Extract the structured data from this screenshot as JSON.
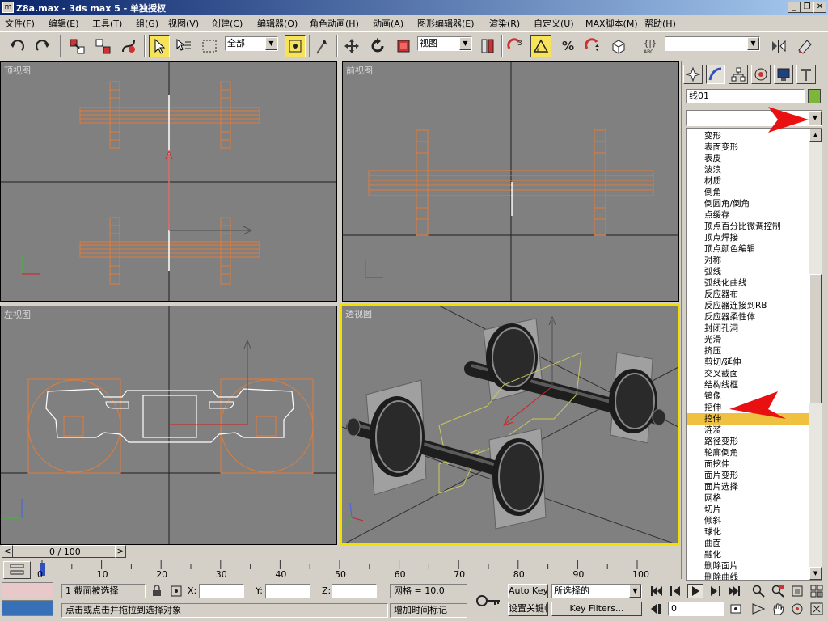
{
  "window": {
    "title": "Z8a.max - 3ds max 5 - 单独授权",
    "icon": "max-app-icon",
    "minimize": "_",
    "maximize": "❐",
    "close": "✕"
  },
  "menu": [
    "文件(F)",
    "编辑(E)",
    "工具(T)",
    "组(G)",
    "视图(V)",
    "创建(C)",
    "编辑器(O)",
    "角色动画(H)",
    "动画(A)",
    "图形编辑器(E)",
    "渲染(R)",
    "自定义(U)",
    "MAX脚本(M)",
    "帮助(H)"
  ],
  "toolbar": {
    "selection_filter": "全部",
    "reference_coord": "视图",
    "named_selection": ""
  },
  "viewports": {
    "top": "顶视图",
    "front": "前视图",
    "left": "左视图",
    "perspective": "透视图"
  },
  "command_panel": {
    "tabs": [
      "create-icon",
      "modify-icon",
      "hierarchy-icon",
      "motion-icon",
      "display-icon",
      "utilities-icon"
    ],
    "object_name": "线01",
    "object_color": "#7cb63c",
    "modifier_dropdown_value": "",
    "modifiers": [
      "变形",
      "表面变形",
      "表皮",
      "波浪",
      "材质",
      "倒角",
      "倒圆角/倒角",
      "点缓存",
      "顶点百分比微调控制",
      "顶点焊接",
      "顶点颜色编辑",
      "对称",
      "弧线",
      "弧线化曲线",
      "反应器布",
      "反应器连接到RB",
      "反应器柔性体",
      "封闭孔洞",
      "光滑",
      "挤压",
      "剪切/延伸",
      "交叉截面",
      "结构线框",
      "镜像",
      "挖伸",
      "挖伸",
      "涟漪",
      "路径变形",
      "轮廓倒角",
      "面挖伸",
      "面片变形",
      "面片选择",
      "网格",
      "切片",
      "倾斜",
      "球化",
      "曲面",
      "融化",
      "删除面片",
      "删除曲线"
    ],
    "selected_modifier_index": 25
  },
  "time_slider": {
    "frame_label": "0 / 100",
    "prev": "<",
    "next": ">"
  },
  "trackbar": {
    "ticks": [
      "0",
      "10",
      "20",
      "30",
      "40",
      "50",
      "60",
      "70",
      "80",
      "90",
      "100"
    ]
  },
  "status": {
    "selection_info": "1 截面被选择",
    "prompt": "点击或点击并拖拉到选择对象",
    "x_label": "X:",
    "y_label": "Y:",
    "z_label": "Z:",
    "x_value": "",
    "y_value": "",
    "z_value": "",
    "grid": "网格 = 10.0",
    "add_time_tag": "增加时间标记",
    "auto_key": "Auto Key",
    "set_key": "设置关键帧",
    "selection_set": "所选择的",
    "key_filters": "Key Filters...",
    "current_frame": "0"
  }
}
